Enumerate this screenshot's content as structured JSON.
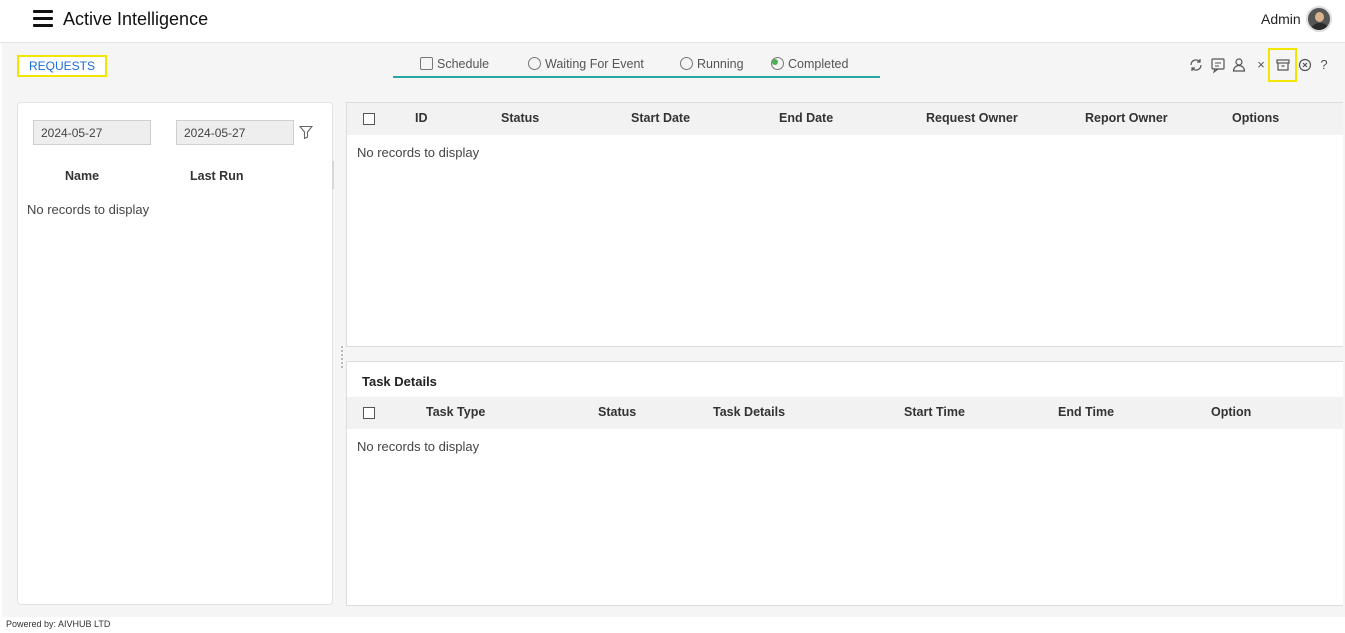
{
  "header": {
    "app_title": "Active Intelligence",
    "user_name": "Admin",
    "menu_icon": "hamburger-icon",
    "avatar": "user-avatar"
  },
  "page": {
    "section_label": "REQUESTS"
  },
  "tabs": [
    {
      "label": "Schedule",
      "icon": "calendar-clock-icon"
    },
    {
      "label": "Waiting For Event",
      "icon": "waiting-icon"
    },
    {
      "label": "Running",
      "icon": "running-icon"
    },
    {
      "label": "Completed",
      "icon": "check-circle-icon",
      "active": true,
      "indicator_color": "#4caf50"
    }
  ],
  "toolbar": {
    "icons": [
      "refresh-icon",
      "comment-icon",
      "user-icon",
      "close-icon",
      "archive-icon",
      "cancel-circle-icon",
      "help-icon"
    ],
    "help_glyph": "?",
    "close_glyph": "×"
  },
  "left_panel": {
    "date_from": "2024-05-27",
    "date_to": "2024-05-27",
    "columns": [
      "Name",
      "Last Run"
    ],
    "empty_text": "No records to display"
  },
  "requests_grid": {
    "columns": [
      "ID",
      "Status",
      "Start Date",
      "End Date",
      "Request Owner",
      "Report Owner",
      "Options"
    ],
    "empty_text": "No records to display"
  },
  "task_details": {
    "title": "Task Details",
    "columns": [
      "Task Type",
      "Status",
      "Task Details",
      "Start Time",
      "End Time",
      "Option"
    ],
    "empty_text": "No records to display"
  },
  "footer": {
    "text": "Powered by: AIVHUB LTD"
  },
  "colors": {
    "accent_blue": "#1b6ad8",
    "highlight_yellow": "#f2e600",
    "tab_underline": "#2aa5a5"
  }
}
